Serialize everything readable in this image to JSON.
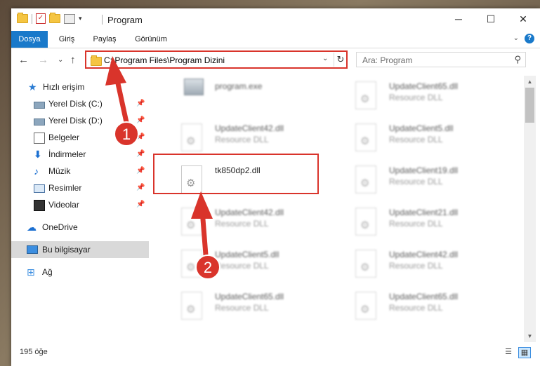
{
  "window": {
    "title": "Program"
  },
  "ribbon": {
    "tabs": [
      "Dosya",
      "Giriş",
      "Paylaş",
      "Görünüm"
    ],
    "help": "?"
  },
  "address": {
    "path": "C:\\Program Files\\Program Dizini"
  },
  "search": {
    "placeholder": "Ara: Program"
  },
  "nav": {
    "items": [
      {
        "label": "Hızlı erişim",
        "icon": "star-icon"
      },
      {
        "label": "Yerel Disk (C:)",
        "icon": "drive-icon",
        "pinned": true
      },
      {
        "label": "Yerel Disk (D:)",
        "icon": "drive-icon",
        "pinned": true
      },
      {
        "label": "Belgeler",
        "icon": "documents-icon",
        "pinned": true
      },
      {
        "label": "İndirmeler",
        "icon": "downloads-icon",
        "pinned": true
      },
      {
        "label": "Müzik",
        "icon": "music-icon",
        "pinned": true
      },
      {
        "label": "Resimler",
        "icon": "pictures-icon",
        "pinned": true
      },
      {
        "label": "Videolar",
        "icon": "videos-icon",
        "pinned": true
      },
      {
        "label": "OneDrive",
        "icon": "onedrive-icon"
      },
      {
        "label": "Bu bilgisayar",
        "icon": "computer-icon",
        "selected": true
      },
      {
        "label": "Ağ",
        "icon": "network-icon"
      }
    ]
  },
  "files": [
    {
      "name": "program.exe",
      "type": ""
    },
    {
      "name": "UpdateClient65.dll",
      "type": "Resource DLL"
    },
    {
      "name": "UpdateClient42.dll",
      "type": "Resource DLL"
    },
    {
      "name": "UpdateClient5.dll",
      "type": "Resource DLL"
    },
    {
      "name": "tk850dp2.dll",
      "type": ""
    },
    {
      "name": "UpdateClient19.dll",
      "type": "Resource DLL"
    },
    {
      "name": "UpdateClient42.dll",
      "type": "Resource DLL"
    },
    {
      "name": "UpdateClient21.dll",
      "type": "Resource DLL"
    },
    {
      "name": "UpdateClient5.dll",
      "type": "Resource DLL"
    },
    {
      "name": "UpdateClient42.dll",
      "type": "Resource DLL"
    },
    {
      "name": "UpdateClient65.dll",
      "type": "Resource DLL"
    },
    {
      "name": "UpdateClient65.dll",
      "type": "Resource DLL"
    }
  ],
  "status": {
    "count": "195 öğe"
  },
  "annotations": {
    "step1": "1",
    "step2": "2"
  },
  "colors": {
    "accent": "#1979ca",
    "annotation": "#d9342b",
    "selected_nav": "#d9d9d9"
  }
}
